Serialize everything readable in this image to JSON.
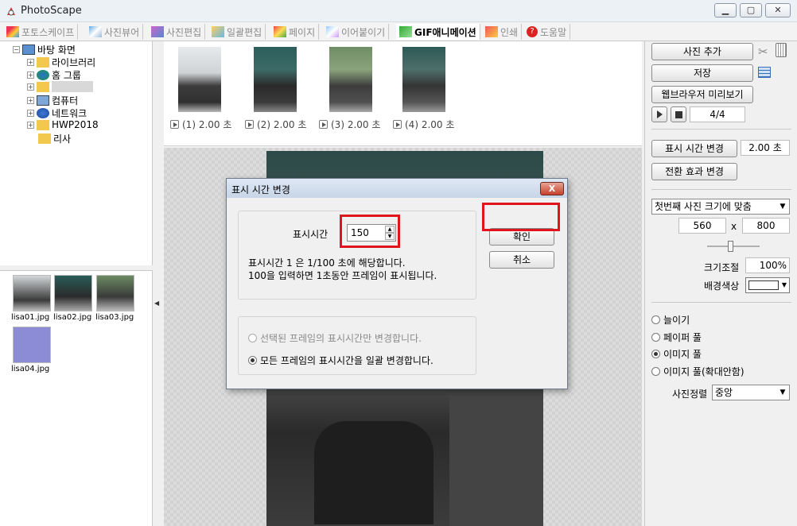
{
  "app": {
    "title": "PhotoScape"
  },
  "tabs": [
    {
      "label": "포토스케이프",
      "active": false
    },
    {
      "label": "사진뷰어",
      "active": false
    },
    {
      "label": "사진편집",
      "active": false
    },
    {
      "label": "일괄편집",
      "active": false
    },
    {
      "label": "페이지",
      "active": false
    },
    {
      "label": "이어붙이기",
      "active": false
    },
    {
      "label": "GIF애니메이션",
      "active": true
    },
    {
      "label": "인쇄",
      "active": false
    },
    {
      "label": "도움말",
      "active": false
    }
  ],
  "tree": {
    "root": "바탕 화면",
    "items": [
      "라이브러리",
      "홈 그룹",
      "",
      "컴퓨터",
      "네트워크",
      "HWP2018",
      "리사"
    ]
  },
  "files": [
    {
      "name": "lisa01.jpg"
    },
    {
      "name": "lisa02.jpg"
    },
    {
      "name": "lisa03.jpg"
    },
    {
      "name": "lisa04.jpg"
    }
  ],
  "frames": [
    {
      "label": "(1) 2.00 초"
    },
    {
      "label": "(2) 2.00 초"
    },
    {
      "label": "(3) 2.00 초"
    },
    {
      "label": "(4) 2.00 초"
    }
  ],
  "right_panel": {
    "add_photo": "사진 추가",
    "save": "저장",
    "browser_preview": "웹브라우저 미리보기",
    "frame_counter": "4/4",
    "change_display_time": "표시 시간 변경",
    "display_time_value": "2.00 초",
    "change_transition": "전환 효과 변경",
    "size_option": "첫번째 사진 크기에 맞춤",
    "width": "560",
    "x_sep": "x",
    "height": "800",
    "resize_label": "크기조절",
    "resize_value": "100%",
    "bg_color_label": "배경색상",
    "fit_options": [
      {
        "label": "늘이기",
        "selected": false
      },
      {
        "label": "페이퍼 풀",
        "selected": false
      },
      {
        "label": "이미지 풀",
        "selected": true
      },
      {
        "label": "이미지 풀(확대안함)",
        "selected": false
      }
    ],
    "align_label": "사진정렬",
    "align_value": "중앙"
  },
  "dialog": {
    "title": "표시 시간 변경",
    "close": "X",
    "time_label": "표시시간",
    "time_value": "150",
    "info_line1": "표시시간 1 은 1/100 초에 해당합니다.",
    "info_line2": "100을 입력하면 1초동안 프레임이 표시됩니다.",
    "ok": "확인",
    "cancel": "취소",
    "option_selected_only": "선택된 프레임의 표시시간만 변경합니다.",
    "option_all": "모든 프레임의 표시시간을 일괄 변경합니다."
  },
  "colors": {
    "highlight_red": "#e0141c",
    "dialog_close": "#c6412d"
  }
}
